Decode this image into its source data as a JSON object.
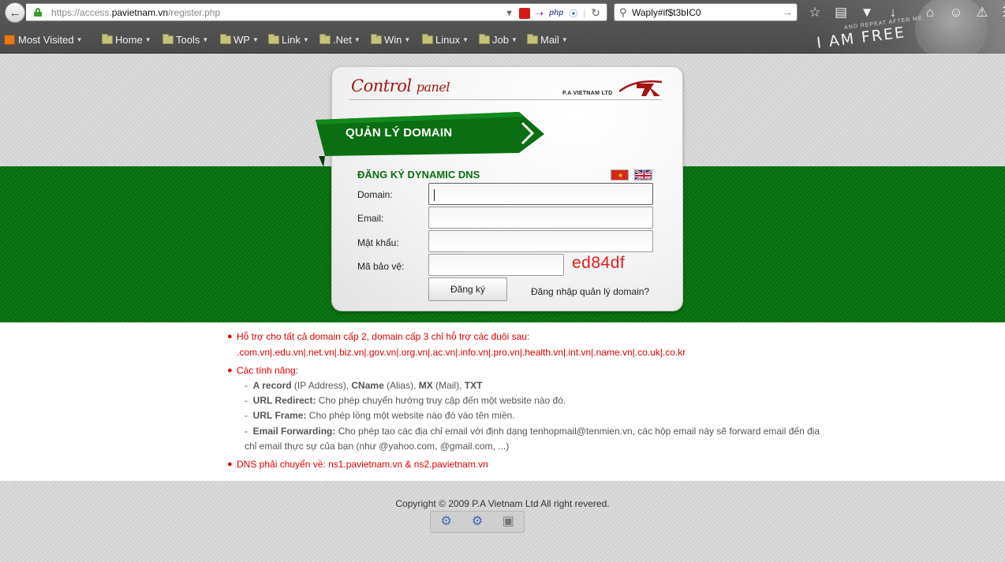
{
  "browser": {
    "url_prefix": "https://access.",
    "url_host": "pavietnam.vn",
    "url_path": "/register.php",
    "search_value": "Waply#if$t3bIC0",
    "php_badge": "php",
    "theme_motto_small": "AND REPEAT AFTER ME",
    "theme_motto_big": "I AM FREE",
    "bookmarks": [
      {
        "label": "Most Visited"
      },
      {
        "label": "Home"
      },
      {
        "label": "Tools"
      },
      {
        "label": "WP"
      },
      {
        "label": "Link"
      },
      {
        "label": ".Net"
      },
      {
        "label": "Win"
      },
      {
        "label": "Linux"
      },
      {
        "label": "Job"
      },
      {
        "label": "Mail"
      }
    ]
  },
  "panel": {
    "title_big": "Control",
    "title_small": "panel",
    "brand": "P.A VIETNAM LTD",
    "ribbon": "QUẢN LÝ DOMAIN"
  },
  "form": {
    "title": "ĐĂNG KÝ DYNAMIC DNS",
    "domain_label": "Domain:",
    "email_label": "Email:",
    "password_label": "Mật khẩu:",
    "captcha_label": "Mã bảo vệ:",
    "captcha_code": "ed84df",
    "submit": "Đăng ký",
    "login_link": "Đăng nhập quản lý domain?",
    "domain_value": "",
    "email_value": "",
    "password_value": "",
    "captcha_value": ""
  },
  "info": {
    "line1": "Hỗ trợ cho tất cả domain cấp 2, domain cấp 3 chỉ hỗ trợ các đuôi sau:",
    "line1b": ".com.vn|.edu.vn|.net.vn|.biz.vn|.gov.vn|.org.vn|.ac.vn|.info.vn|.pro.vn|.health.vn|.int.vn|.name.vn|.co.uk|.co.kr",
    "features_title": "Các tính năng:",
    "f1_a": "A record",
    "f1_b": " (IP Address), ",
    "f1_c": "CName",
    "f1_d": " (Alias), ",
    "f1_e": "MX",
    "f1_f": " (Mail), ",
    "f1_g": "TXT",
    "f2_title": "URL Redirect:",
    "f2_text": " Cho phép chuyển hướng truy cập đến một website nào đó.",
    "f3_title": "URL Frame:",
    "f3_text": " Cho phép lồng một website nào đó vào tên miền.",
    "f4_title": "Email Forwarding:",
    "f4_text": " Cho phép tạo các địa chỉ email với định dạng tenhopmail@tenmien.vn, các hộp email này sẽ forward email đến địa",
    "f4_text2": "chỉ email thực sự của bạn (như @yahoo.com, @gmail.com, ...)",
    "dns": "DNS phải chuyển về: ns1.pavietnam.vn & ns2.pavietnam.vn"
  },
  "footer": {
    "copyright": "Copyright © 2009 P.A Vietnam Ltd All right revered."
  },
  "colors": {
    "green": "#0b7312",
    "red": "#e10000",
    "brand_red": "#a11414"
  }
}
